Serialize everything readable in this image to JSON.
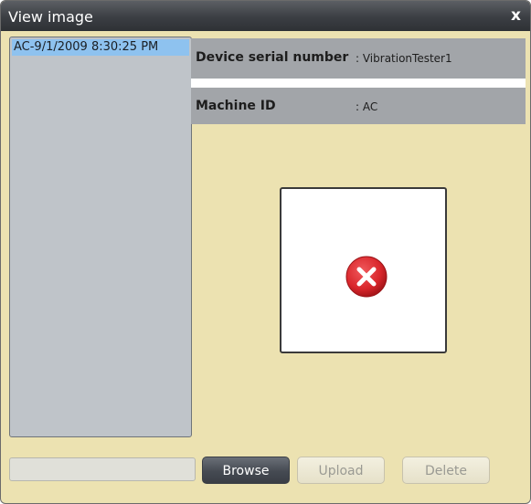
{
  "window": {
    "title": "View image",
    "close_label": "x"
  },
  "list": {
    "items": [
      {
        "label": "AC-9/1/2009 8:30:25 PM",
        "selected": true
      }
    ]
  },
  "info": {
    "device_serial_label": "Device serial number",
    "device_serial_value": ": VibrationTester1",
    "machine_id_label": "Machine ID",
    "machine_id_value": ": AC"
  },
  "image_preview": {
    "icon": "error-icon",
    "status": "error"
  },
  "file_path": {
    "value": ""
  },
  "buttons": {
    "browse": "Browse",
    "upload": "Upload",
    "delete": "Delete"
  },
  "colors": {
    "background": "#ece2b1",
    "titlebar": "#3b3e43",
    "list_bg": "#bfc4c9",
    "selected_item": "#8ec2ef",
    "info_row": "#a2a5a9",
    "error_red": "#d9262b"
  }
}
